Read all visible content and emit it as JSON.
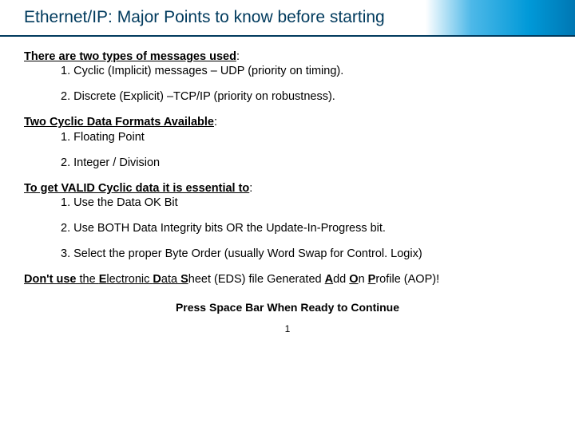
{
  "title": "Ethernet/IP: Major Points to know before starting",
  "section1": {
    "heading": "There are two types of messages used",
    "items": [
      "1.  Cyclic (Implicit) messages – UDP (priority on timing).",
      "2.  Discrete (Explicit) –TCP/IP (priority on robustness)."
    ]
  },
  "section2": {
    "heading": "Two Cyclic Data Formats Available",
    "items": [
      "1. Floating Point",
      "2. Integer / Division"
    ]
  },
  "section3": {
    "heading": "To get VALID Cyclic data it is essential to",
    "items": [
      "1. Use the Data OK Bit",
      "2. Use BOTH Data Integrity bits OR the Update-In-Progress bit.",
      "3. Select the proper Byte Order (usually Word Swap for Control. Logix)"
    ]
  },
  "warning": {
    "dont_b": "Don't use",
    "mid1": " the ",
    "e_b": "E",
    "e_rest": "lectronic ",
    "d_b": "D",
    "d_rest": "ata ",
    "s_b": "S",
    "s_rest": "heet (EDS) file Generated ",
    "a_b": "A",
    "a_rest": "dd ",
    "o_b": "O",
    "o_rest": "n ",
    "p_b": "P",
    "p_rest": "rofile (AOP)!"
  },
  "footer": "Press Space Bar When Ready to Continue",
  "page": "1"
}
